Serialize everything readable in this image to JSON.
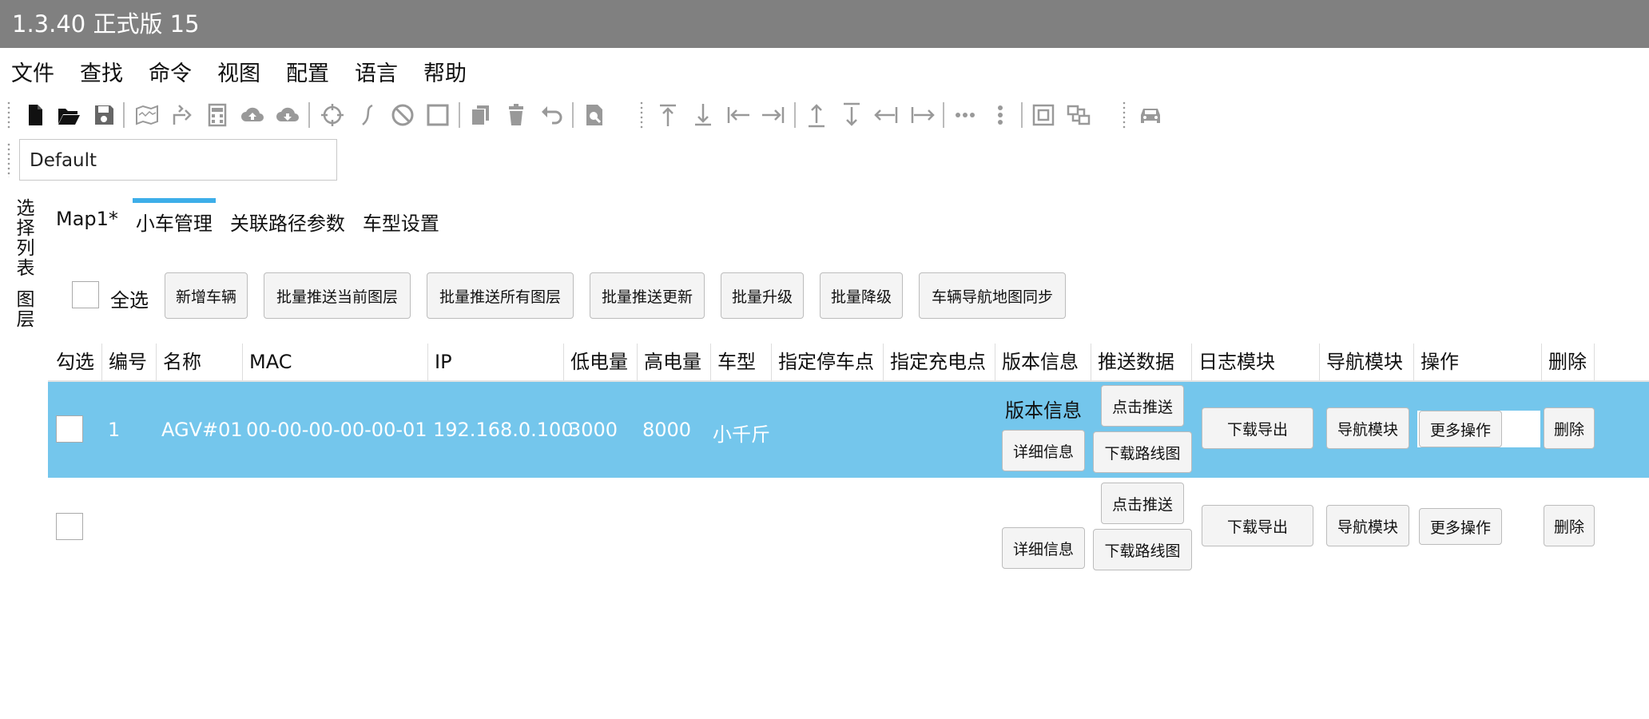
{
  "window": {
    "title": "1.3.40 正式版 15"
  },
  "menu": [
    "文件",
    "查找",
    "命令",
    "视图",
    "配置",
    "语言",
    "帮助"
  ],
  "toolbar_icons": [
    "new-file-icon",
    "open-folder-icon",
    "save-icon",
    "map-icon",
    "route-icon",
    "calculator-icon",
    "cloud-upload-icon",
    "cloud-download-icon",
    "target-icon",
    "curve-icon",
    "forbidden-icon",
    "square-icon",
    "copy-icon",
    "delete-icon",
    "undo-icon",
    "search-doc-icon",
    "align-top-icon",
    "align-bottom-icon",
    "align-left-icon",
    "align-right-icon",
    "distribute-up-icon",
    "distribute-down-icon",
    "distribute-left-icon",
    "distribute-right-icon",
    "more-horizontal-icon",
    "more-vertical-icon",
    "fit-view-icon",
    "group-icon",
    "car-icon"
  ],
  "layer_combo": {
    "value": "Default"
  },
  "side_tabs": [
    "选择列表",
    "图层"
  ],
  "tabs": [
    "Map1*",
    "小车管理",
    "关联路径参数",
    "车型设置"
  ],
  "active_tab": 1,
  "actions": {
    "select_all": "全选",
    "buttons": [
      "新增车辆",
      "批量推送当前图层",
      "批量推送所有图层",
      "批量推送更新",
      "批量升级",
      "批量降级",
      "车辆导航地图同步"
    ]
  },
  "table": {
    "columns": [
      "勾选",
      "编号",
      "名称",
      "MAC",
      "IP",
      "低电量",
      "高电量",
      "车型",
      "指定停车点",
      "指定充电点",
      "版本信息",
      "推送数据",
      "日志模块",
      "导航模块",
      "操作",
      "删除"
    ],
    "rows": [
      {
        "selected": true,
        "id": "1",
        "name": "AGV#01",
        "mac": "00-00-00-00-00-01",
        "ip": "192.168.0.100",
        "low": "3000",
        "high": "8000",
        "type": "小千斤",
        "park": "",
        "charge": "",
        "version_text": "版本信息"
      },
      {
        "selected": false,
        "id": "",
        "name": "",
        "mac": "",
        "ip": "",
        "low": "",
        "high": "",
        "type": "",
        "park": "",
        "charge": "",
        "version_text": ""
      }
    ],
    "row_buttons": {
      "detail": "详细信息",
      "push": "点击推送",
      "download_route": "下载路线图",
      "export_log": "下载导出",
      "nav": "导航模块",
      "more": "更多操作",
      "delete": "删除"
    }
  },
  "colors": {
    "titlebar": "#808080",
    "selected_row": "#74c6ec",
    "tab_accent": "#3daee9"
  }
}
